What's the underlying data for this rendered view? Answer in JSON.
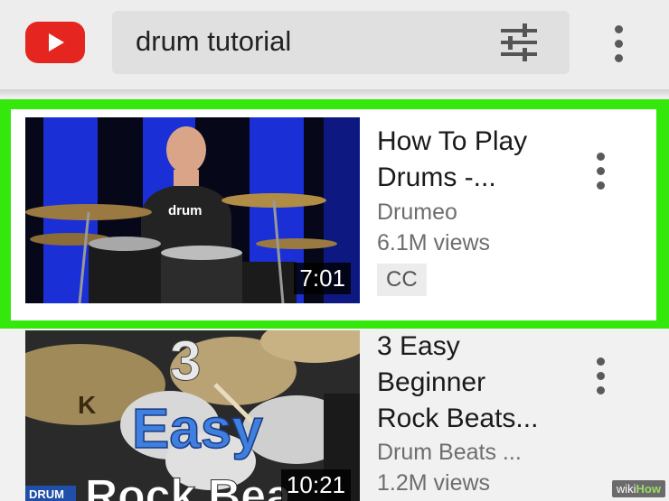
{
  "header": {
    "logo_icon": "youtube-logo-icon",
    "search_query": "drum tutorial",
    "filter_icon": "sliders-filter-icon",
    "menu_icon": "more-vertical-icon"
  },
  "results": [
    {
      "title_line1": "How To Play",
      "title_line2": "Drums -...",
      "channel": "Drumeo",
      "views": "6.1M views",
      "badge": "CC",
      "duration": "7:01",
      "thumbnail_shirt_text": "drum",
      "selected": true
    },
    {
      "title_line1": "3 Easy",
      "title_line2": "Beginner",
      "title_line3": "Rock Beats...",
      "channel": "Drum Beats ...",
      "views": "1.2M views",
      "duration": "10:21",
      "thumb_text_number": "3",
      "thumb_text_easy": "Easy",
      "thumb_text_rock": "Rock Bea",
      "thumb_brand": "DRUM",
      "cymbal_letter": "K",
      "selected": false
    }
  ],
  "watermark": {
    "prefix": "wiki",
    "suffix": "How"
  },
  "colors": {
    "highlight": "#35e80c",
    "youtube_red": "#e52620",
    "thumb_blue": "#1a2fd6"
  }
}
